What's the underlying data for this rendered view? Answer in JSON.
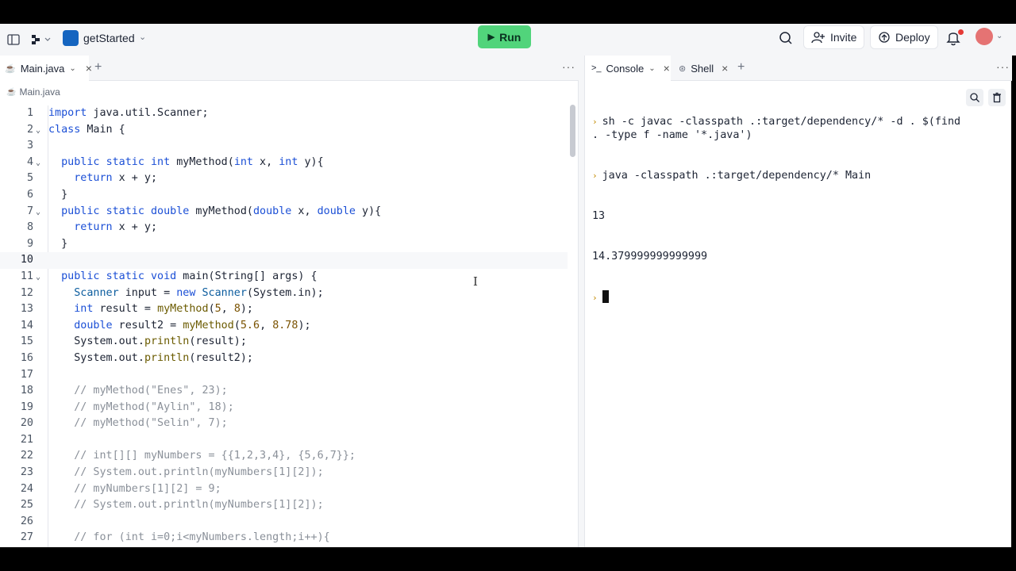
{
  "topbar": {
    "repl_name": "getStarted",
    "run_label": "Run",
    "invite_label": "Invite",
    "deploy_label": "Deploy"
  },
  "editor": {
    "tab_label": "Main.java",
    "breadcrumb": "Main.java",
    "lines": [
      {
        "n": "1"
      },
      {
        "n": "2"
      },
      {
        "n": "3"
      },
      {
        "n": "4"
      },
      {
        "n": "5"
      },
      {
        "n": "6"
      },
      {
        "n": "7"
      },
      {
        "n": "8"
      },
      {
        "n": "9"
      },
      {
        "n": "10"
      },
      {
        "n": "11"
      },
      {
        "n": "12"
      },
      {
        "n": "13"
      },
      {
        "n": "14"
      },
      {
        "n": "15"
      },
      {
        "n": "16"
      },
      {
        "n": "17"
      },
      {
        "n": "18"
      },
      {
        "n": "19"
      },
      {
        "n": "20"
      },
      {
        "n": "21"
      },
      {
        "n": "22"
      },
      {
        "n": "23"
      },
      {
        "n": "24"
      },
      {
        "n": "25"
      },
      {
        "n": "26"
      },
      {
        "n": "27"
      }
    ]
  },
  "console": {
    "tab_console": "Console",
    "tab_shell": "Shell",
    "output": [
      "sh -c javac -classpath .:target/dependency/* -d . $(find . -type f -name '*.java')",
      "java -classpath .:target/dependency/* Main",
      "13",
      "14.379999999999999"
    ]
  },
  "colors": {
    "run_button": "#51d47b",
    "keyword": "#1b4fd6",
    "comment": "#8a9099",
    "prompt": "#c28a00"
  }
}
